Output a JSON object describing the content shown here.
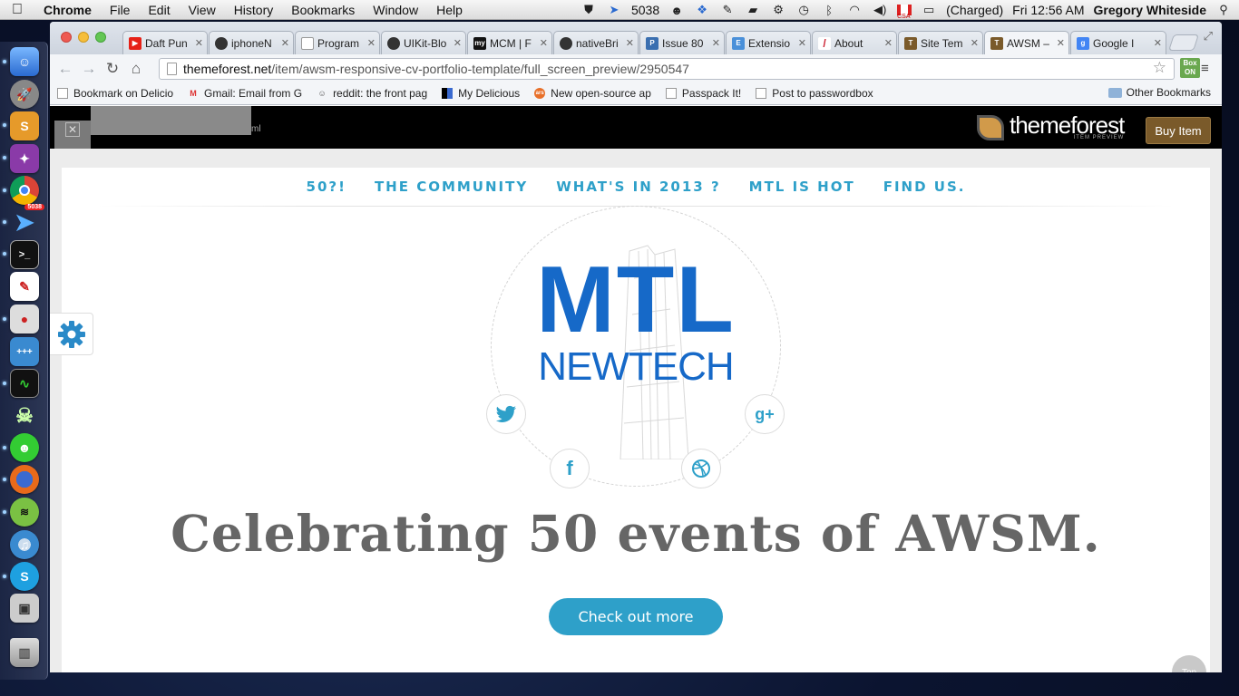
{
  "menubar": {
    "app": "Chrome",
    "items": [
      "File",
      "Edit",
      "View",
      "History",
      "Bookmarks",
      "Window",
      "Help"
    ],
    "status": {
      "mail_count": "5038",
      "battery": "(Charged)",
      "flag_label": "CSA",
      "clock": "Fri 12:56 AM",
      "user": "Gregory Whiteside"
    }
  },
  "dock": {
    "icons": [
      "finder-icon",
      "rocket-icon",
      "sublime-icon",
      "app-icon",
      "chrome-icon",
      "sparrow-icon",
      "terminal-icon",
      "pdf-icon",
      "screen-recorder-icon",
      "calculator-icon",
      "activity-monitor-icon",
      "alien-icon",
      "android-icon",
      "firefox-icon",
      "spotify-icon",
      "itunes-icon",
      "skype-icon",
      "preview-icon",
      "trash-icon"
    ],
    "sparrow_badge": "5038"
  },
  "browser": {
    "tabs": [
      {
        "title": "Daft Pun",
        "icon": "youtube-icon",
        "color": "#e62117",
        "glyph": "▶"
      },
      {
        "title": "iphoneN",
        "icon": "github-icon",
        "color": "#333333",
        "glyph": "●"
      },
      {
        "title": "Program",
        "icon": "page-icon",
        "color": "#bbbbbb",
        "glyph": ""
      },
      {
        "title": "UIKit-Blo",
        "icon": "github-icon",
        "color": "#333333",
        "glyph": "●"
      },
      {
        "title": "MCM | F",
        "icon": "my-icon",
        "color": "#111111",
        "glyph": "my"
      },
      {
        "title": "nativeBri",
        "icon": "github-icon",
        "color": "#333333",
        "glyph": "●"
      },
      {
        "title": "Issue 80",
        "icon": "pivotal-icon",
        "color": "#3a6fb0",
        "glyph": "P"
      },
      {
        "title": "Extensio",
        "icon": "extension-icon",
        "color": "#4a90d9",
        "glyph": "E"
      },
      {
        "title": "About",
        "icon": "about-icon",
        "color": "#cc2233",
        "glyph": "/"
      },
      {
        "title": "Site Tem",
        "icon": "themeforest-icon",
        "color": "#7a5a2a",
        "glyph": "T"
      },
      {
        "title": "AWSM –",
        "icon": "themeforest-icon",
        "color": "#7a5a2a",
        "glyph": "T"
      },
      {
        "title": "Google I",
        "icon": "google-icon",
        "color": "#4285f4",
        "glyph": "g"
      }
    ],
    "url_host": "themeforest.net",
    "url_path": "/item/awsm-responsive-cv-portfolio-template/full_screen_preview/2950547",
    "extension_label": "Box ON",
    "bookmarks": [
      {
        "label": "Bookmark on Delicio",
        "icon": "page-icon"
      },
      {
        "label": "Gmail: Email from G",
        "icon": "gmail-icon"
      },
      {
        "label": "reddit: the front pag",
        "icon": "reddit-icon"
      },
      {
        "label": "My Delicious",
        "icon": "delicious-icon"
      },
      {
        "label": "New open-source ap",
        "icon": "ars-icon"
      },
      {
        "label": "Passpack It!",
        "icon": "page-icon"
      },
      {
        "label": "Post to passwordbox",
        "icon": "page-icon"
      }
    ],
    "other_bookmarks": "Other Bookmarks"
  },
  "preview_bar": {
    "close": "✕",
    "redacted_suffix": "ml",
    "logo_text": "themeforest",
    "logo_sub": "ITEM PREVIEW",
    "buy_label": "Buy Item"
  },
  "site": {
    "nav": [
      "50?!",
      "THE COMMUNITY",
      "WHAT'S IN 2013 ?",
      "MTL IS HOT",
      "FIND US."
    ],
    "logo_line1": "MTL",
    "logo_line2": "NEWTECH",
    "social": {
      "twitter": "twitter",
      "google": "g+",
      "facebook": "f",
      "dribbble": "dribbble"
    },
    "headline": "Celebrating 50 events of AWSM.",
    "cta": "Check out more",
    "top_label": "Top"
  },
  "colors": {
    "accent": "#2ea0c9",
    "logo_blue": "#1669c8",
    "headline_gray": "#666666",
    "themeforest_brown": "#7a5a2a"
  }
}
